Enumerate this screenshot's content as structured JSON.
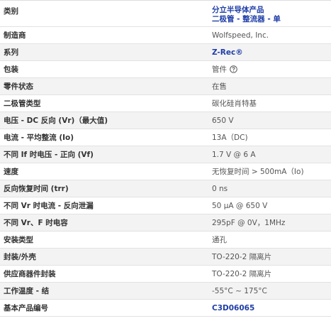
{
  "header": {
    "label": "类别",
    "category_line1": "分立半导体产品",
    "category_line2": "二极管 - 整流器 - 单"
  },
  "rows": [
    {
      "label": "制造商",
      "value": "Wolfspeed, Inc.",
      "kind": "plain"
    },
    {
      "label": "系列",
      "value": "Z-Rec®",
      "kind": "link"
    },
    {
      "label": "包装",
      "value": "管件",
      "kind": "help",
      "icon": "question-circle-icon"
    },
    {
      "label": "零件状态",
      "value": "在售",
      "kind": "plain"
    },
    {
      "label": "二极管类型",
      "value": "碳化硅肖特基",
      "kind": "plain"
    },
    {
      "label": "电压 - DC 反向 (Vr)（最大值)",
      "value": "650 V",
      "kind": "plain"
    },
    {
      "label": "电流 - 平均整流 (Io)",
      "value": "13A（DC)",
      "kind": "plain"
    },
    {
      "label": "不同 If 时电压 - 正向 (Vf)",
      "value": "1.7 V @ 6 A",
      "kind": "plain"
    },
    {
      "label": "速度",
      "value": "无恢复时间 > 500mA（Io)",
      "kind": "plain"
    },
    {
      "label": "反向恢复时间 (trr)",
      "value": "0 ns",
      "kind": "plain"
    },
    {
      "label": "不同 Vr 时电流 - 反向泄漏",
      "value": "50 µA @ 650 V",
      "kind": "plain"
    },
    {
      "label": "不同 Vr、F 时电容",
      "value": "295pF @ 0V，1MHz",
      "kind": "plain"
    },
    {
      "label": "安装类型",
      "value": "通孔",
      "kind": "plain"
    },
    {
      "label": "封装/外壳",
      "value": "TO-220-2 隔离片",
      "kind": "plain"
    },
    {
      "label": "供应商器件封装",
      "value": "TO-220-2 隔离片",
      "kind": "plain"
    },
    {
      "label": "工作温度 - 结",
      "value": "-55°C ~ 175°C",
      "kind": "plain"
    },
    {
      "label": "基本产品编号",
      "value": "C3D06065",
      "kind": "link"
    }
  ],
  "colors": {
    "link": "#1f3ea7",
    "alt_row": "#f3f3f3",
    "border": "#e2e2e2"
  }
}
